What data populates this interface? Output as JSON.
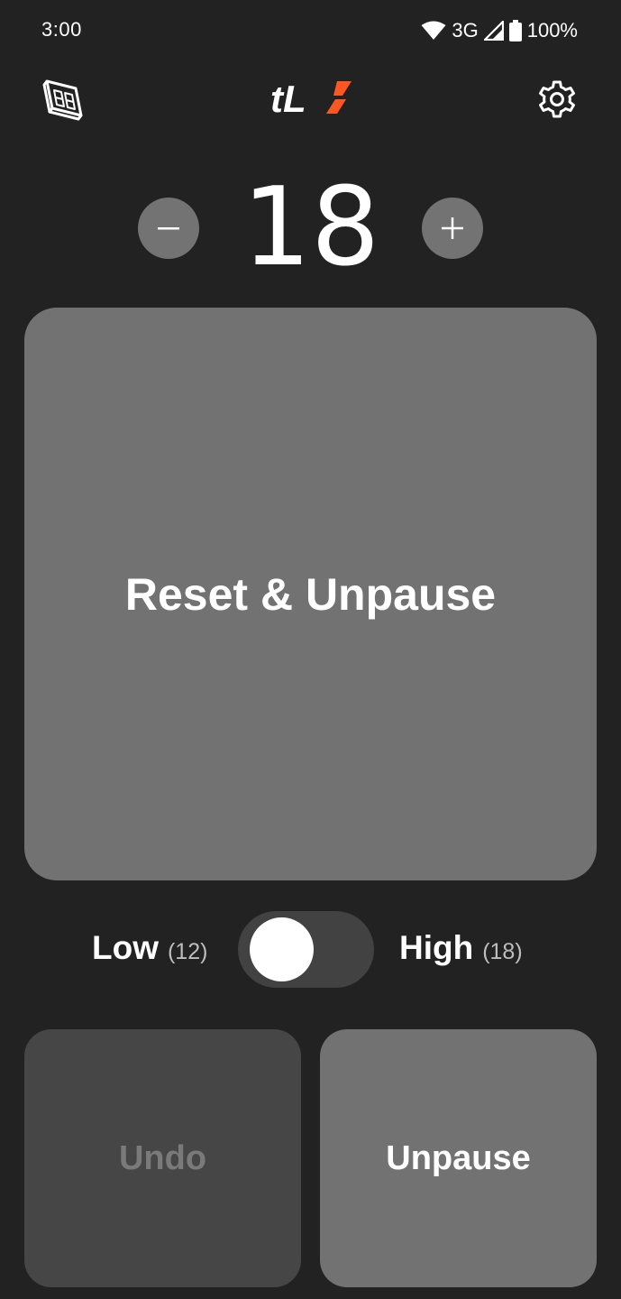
{
  "status_bar": {
    "time": "3:00",
    "network": "3G",
    "battery": "100%",
    "icons": [
      "wifi-icon",
      "cell-signal-icon",
      "battery-icon"
    ]
  },
  "topbar": {
    "left_icon": "counter-display-icon",
    "logo_text": "tL",
    "logo_accent_color": "#ff5722",
    "right_icon": "gear-icon"
  },
  "counter": {
    "value": "18",
    "decrement_symbol": "−",
    "increment_symbol": "+"
  },
  "main_button": {
    "label": "Reset & Unpause"
  },
  "toggle": {
    "low_label": "Low",
    "low_value": "(12)",
    "high_label": "High",
    "high_value": "(18)",
    "state": "low"
  },
  "actions": {
    "undo_label": "Undo",
    "unpause_label": "Unpause"
  }
}
